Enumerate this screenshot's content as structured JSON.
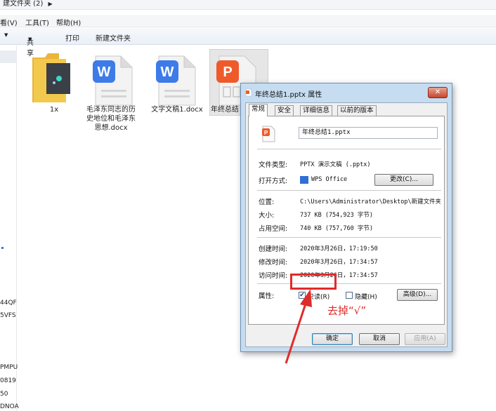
{
  "window": {
    "title": "建文件夹 (2)"
  },
  "menu": {
    "items": [
      "看(V)",
      "工具(T)",
      "帮助(H)"
    ]
  },
  "toolbar": {
    "share": "共享",
    "print": "打印",
    "new_folder": "新建文件夹"
  },
  "nav_pane": {
    "truncated_labels": [
      "44QF",
      "5VFS",
      "PMPU",
      "0819",
      "50",
      "DNOA"
    ]
  },
  "files": [
    {
      "name": "1x",
      "kind": "folder"
    },
    {
      "name": "毛泽东同志的历史地位和毛泽东思想.docx",
      "kind": "docx",
      "icon_letter": "W"
    },
    {
      "name": "文字文稿1.docx",
      "kind": "docx",
      "icon_letter": "W"
    },
    {
      "name": "年终总结",
      "kind": "pptx",
      "icon_letter": "P"
    }
  ],
  "dialog": {
    "title": "年终总结1.pptx 属性",
    "close_label": "✕",
    "tabs": [
      "常规",
      "安全",
      "详细信息",
      "以前的版本"
    ],
    "active_tab": "常规",
    "file_name_value": "年终总结1.pptx",
    "rows": {
      "type_label": "文件类型:",
      "type_value": "PPTX 演示文稿 (.pptx)",
      "opens_label": "打开方式:",
      "opens_value": "WPS Office",
      "change_button": "更改(C)...",
      "location_label": "位置:",
      "location_value": "C:\\Users\\Administrator\\Desktop\\新建文件夹",
      "size_label": "大小:",
      "size_value": "737 KB (754,923 字节)",
      "disk_label": "占用空间:",
      "disk_value": "740 KB (757,760 字节)",
      "created_label": "创建时间:",
      "created_value": "2020年3月26日，17:19:50",
      "modified_label": "修改时间:",
      "modified_value": "2020年3月26日，17:34:57",
      "accessed_label": "访问时间:",
      "accessed_value": "2020年3月26日，17:34:57",
      "attributes_label": "属性:",
      "readonly_label": "只读(R)",
      "readonly_checked": true,
      "hidden_label": "隐藏(H)",
      "hidden_checked": false,
      "advanced_button": "高级(D)..."
    },
    "footer": {
      "ok": "确定",
      "cancel": "取消",
      "apply": "应用(A)"
    }
  },
  "annotation": {
    "text": "去掉“√”",
    "color": "#e02b2b"
  },
  "colors": {
    "word_blue": "#3d7be8",
    "ppt_orange": "#ef5a2a",
    "folder_yellow": "#f2c94c"
  }
}
